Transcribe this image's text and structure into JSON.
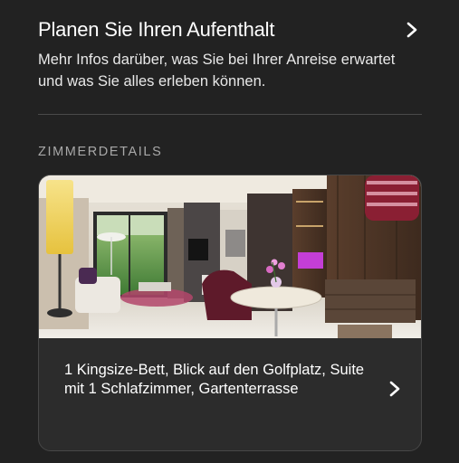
{
  "plan": {
    "title": "Planen Sie Ihren Aufenthalt",
    "description": "Mehr Infos darüber, was Sie bei Ihrer Anreise erwartet und was Sie alles erleben können."
  },
  "room_section": {
    "label": "ZIMMERDETAILS",
    "room": {
      "description": "1 Kingsize-Bett, Blick auf den Golfplatz, Suite mit 1 Schlafzimmer, Gartenterrasse"
    }
  },
  "icons": {
    "plan_chevron": "chevron-right-icon",
    "room_chevron": "chevron-right-icon"
  },
  "colors": {
    "background": "#222222",
    "card": "#2c2c2c",
    "text_primary": "#ffffff",
    "text_muted": "#a8a8a8",
    "divider": "#4a4a4a"
  }
}
